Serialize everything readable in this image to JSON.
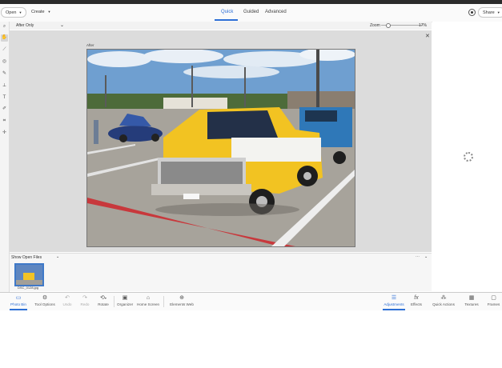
{
  "topbar": {
    "open_label": "Open",
    "create_label": "Create",
    "tabs": [
      "Quick",
      "Guided",
      "Advanced"
    ],
    "active_tab": "Quick",
    "share_label": "Share"
  },
  "docbar": {
    "view_label": "After Only",
    "zoom_label": "Zoom",
    "zoom_value": "17%",
    "zoom_level": 0.17
  },
  "canvas": {
    "after_label": "After"
  },
  "photo_bin": {
    "show_label": "Show Open Files",
    "thumb_filename": "DSC_0128.jpg"
  },
  "bottombar": {
    "left_items": [
      "Photo Bin",
      "Tool Options",
      "Undo",
      "Redo",
      "Rotate",
      "Organizer",
      "Home Screen",
      "Elements Web"
    ],
    "right_items": [
      "Adjustments",
      "Effects",
      "Quick Actions",
      "Textures",
      "Frames"
    ],
    "active_left": "Photo Bin",
    "active_right": "Adjustments"
  },
  "colors": {
    "accent": "#2d6fd6"
  }
}
